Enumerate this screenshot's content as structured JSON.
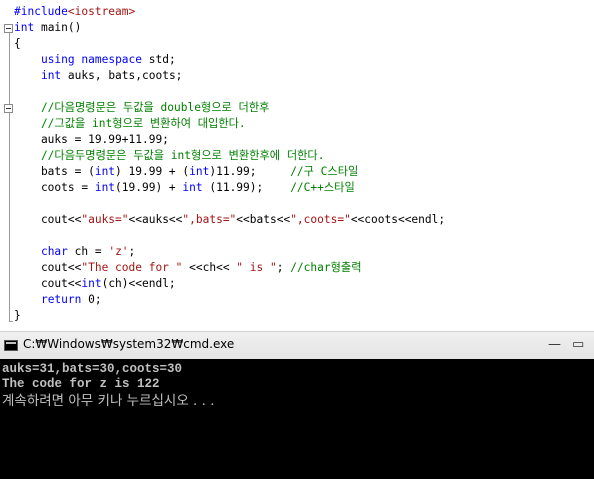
{
  "editor": {
    "lines": [
      {
        "segments": [
          {
            "t": "#include",
            "c": "pp"
          },
          {
            "t": "<iostream>",
            "c": "pp-inc"
          }
        ]
      },
      {
        "segments": [
          {
            "t": "int",
            "c": "kw"
          },
          {
            "t": " main()",
            "c": ""
          }
        ]
      },
      {
        "segments": [
          {
            "t": "{",
            "c": ""
          }
        ]
      },
      {
        "segments": [
          {
            "t": "    ",
            "c": ""
          },
          {
            "t": "using",
            "c": "kw"
          },
          {
            "t": " ",
            "c": ""
          },
          {
            "t": "namespace",
            "c": "kw"
          },
          {
            "t": " std;",
            "c": ""
          }
        ]
      },
      {
        "segments": [
          {
            "t": "    ",
            "c": ""
          },
          {
            "t": "int",
            "c": "kw"
          },
          {
            "t": " auks, bats,coots;",
            "c": ""
          }
        ]
      },
      {
        "segments": [
          {
            "t": "",
            "c": ""
          }
        ]
      },
      {
        "segments": [
          {
            "t": "    //다음명령문은 두값을 double형으로 더한후",
            "c": "cm"
          }
        ]
      },
      {
        "segments": [
          {
            "t": "    //그값을 int형으로 변환하여 대입한다.",
            "c": "cm"
          }
        ]
      },
      {
        "segments": [
          {
            "t": "    auks = 19.99+11.99;",
            "c": ""
          }
        ]
      },
      {
        "segments": [
          {
            "t": "    //다음두명령문은 두값을 int형으로 변환한후에 더한다.",
            "c": "cm"
          }
        ]
      },
      {
        "segments": [
          {
            "t": "    bats = (",
            "c": ""
          },
          {
            "t": "int",
            "c": "kw"
          },
          {
            "t": ") 19.99 + (",
            "c": ""
          },
          {
            "t": "int",
            "c": "kw"
          },
          {
            "t": ")11.99;     ",
            "c": ""
          },
          {
            "t": "//구 C스타일",
            "c": "cm"
          }
        ]
      },
      {
        "segments": [
          {
            "t": "    coots = ",
            "c": ""
          },
          {
            "t": "int",
            "c": "kw"
          },
          {
            "t": "(19.99) + ",
            "c": ""
          },
          {
            "t": "int",
            "c": "kw"
          },
          {
            "t": " (11.99);    ",
            "c": ""
          },
          {
            "t": "//C++스타일",
            "c": "cm"
          }
        ]
      },
      {
        "segments": [
          {
            "t": "",
            "c": ""
          }
        ]
      },
      {
        "segments": [
          {
            "t": "    cout<<",
            "c": ""
          },
          {
            "t": "\"auks=\"",
            "c": "st"
          },
          {
            "t": "<<auks<<",
            "c": ""
          },
          {
            "t": "\",bats=\"",
            "c": "st"
          },
          {
            "t": "<<bats<<",
            "c": ""
          },
          {
            "t": "\",coots=\"",
            "c": "st"
          },
          {
            "t": "<<coots<<endl;",
            "c": ""
          }
        ]
      },
      {
        "segments": [
          {
            "t": "",
            "c": ""
          }
        ]
      },
      {
        "segments": [
          {
            "t": "    ",
            "c": ""
          },
          {
            "t": "char",
            "c": "kw"
          },
          {
            "t": " ch = ",
            "c": ""
          },
          {
            "t": "'z'",
            "c": "st"
          },
          {
            "t": ";",
            "c": ""
          }
        ]
      },
      {
        "segments": [
          {
            "t": "    cout<<",
            "c": ""
          },
          {
            "t": "\"The code for \"",
            "c": "st"
          },
          {
            "t": " <<ch<< ",
            "c": ""
          },
          {
            "t": "\" is \"",
            "c": "st"
          },
          {
            "t": "; ",
            "c": ""
          },
          {
            "t": "//char형출력",
            "c": "cm"
          }
        ]
      },
      {
        "segments": [
          {
            "t": "    cout<<",
            "c": ""
          },
          {
            "t": "int",
            "c": "kw"
          },
          {
            "t": "(ch)<<endl;",
            "c": ""
          }
        ]
      },
      {
        "segments": [
          {
            "t": "    ",
            "c": ""
          },
          {
            "t": "return",
            "c": "kw"
          },
          {
            "t": " 0;",
            "c": ""
          }
        ]
      },
      {
        "segments": [
          {
            "t": "}",
            "c": ""
          }
        ]
      }
    ]
  },
  "cmd": {
    "title": "C:₩Windows₩system32₩cmd.exe",
    "minimize_label": "—",
    "maximize_label": "▭",
    "icon": "console-icon",
    "output": [
      "auks=31,bats=30,coots=30",
      "The code for z is 122"
    ],
    "prompt": "계속하려면 아무 키나 누르십시오 . . ."
  }
}
